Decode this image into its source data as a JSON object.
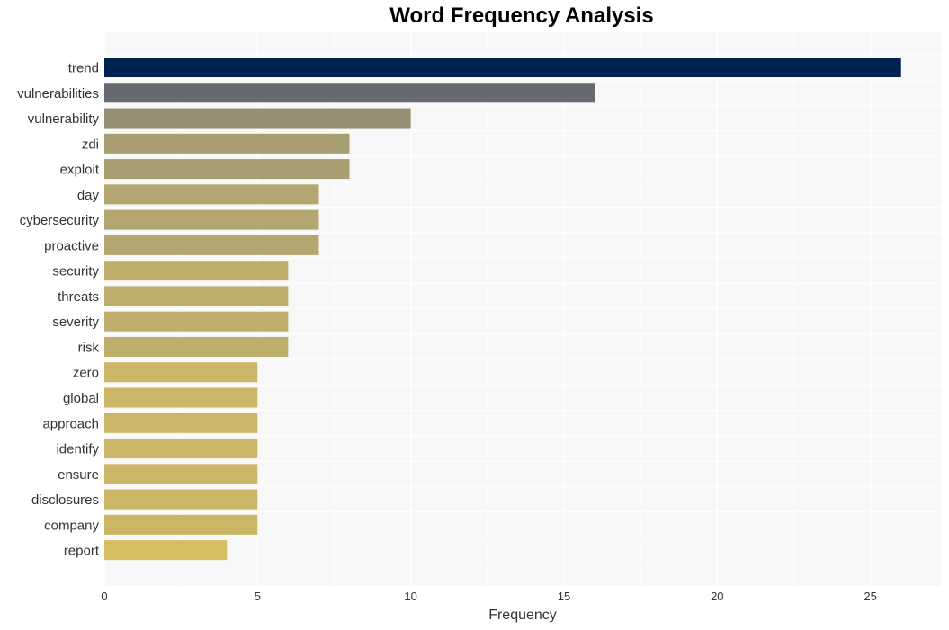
{
  "chart_data": {
    "type": "bar",
    "orientation": "horizontal",
    "title": "Word Frequency Analysis",
    "xlabel": "Frequency",
    "ylabel": "",
    "xlim": [
      0,
      27.3
    ],
    "xticks": [
      0,
      5,
      10,
      15,
      20,
      25
    ],
    "grid": true,
    "categories": [
      "trend",
      "vulnerabilities",
      "vulnerability",
      "zdi",
      "exploit",
      "day",
      "cybersecurity",
      "proactive",
      "security",
      "threats",
      "severity",
      "risk",
      "zero",
      "global",
      "approach",
      "identify",
      "ensure",
      "disclosures",
      "company",
      "report"
    ],
    "values": [
      26,
      16,
      10,
      8,
      8,
      7,
      7,
      7,
      6,
      6,
      6,
      6,
      5,
      5,
      5,
      5,
      5,
      5,
      5,
      4
    ],
    "colors": [
      "#00224e",
      "#666970",
      "#968f74",
      "#a99e72",
      "#a99e72",
      "#b3a670",
      "#b3a670",
      "#b3a670",
      "#beae6c",
      "#beae6c",
      "#beae6c",
      "#beae6c",
      "#cab666",
      "#cab666",
      "#cab666",
      "#cab666",
      "#cab666",
      "#cab666",
      "#cab666",
      "#d5bf5e"
    ],
    "background": "#f7f7f7"
  }
}
